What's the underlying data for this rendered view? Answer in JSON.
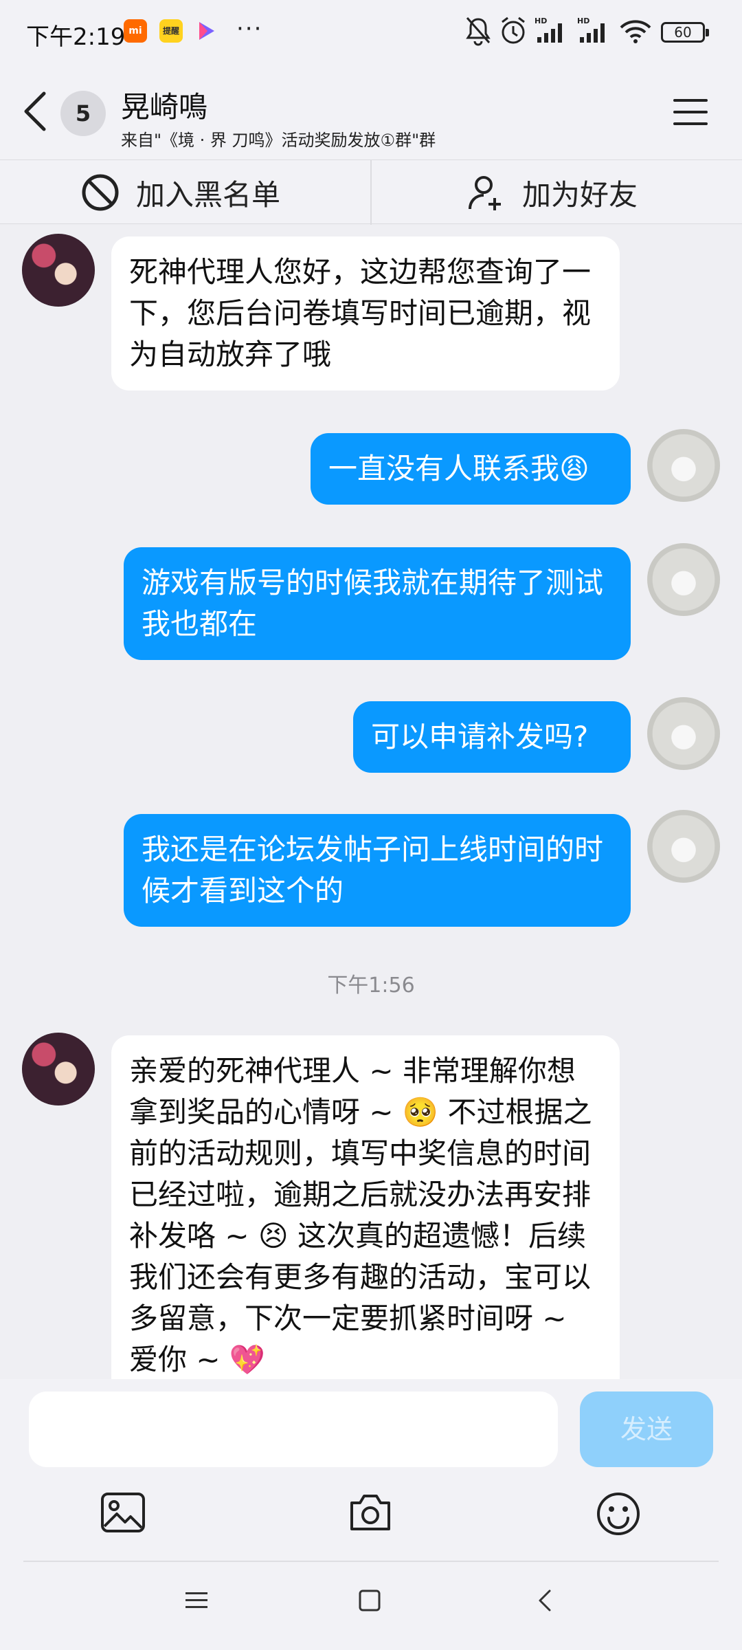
{
  "status_bar": {
    "time": "下午2:19",
    "apps": [
      "mi",
      "提醒",
      "play"
    ],
    "more": "···",
    "battery": "60"
  },
  "header": {
    "unread_count": "5",
    "title": "晃崎鳴",
    "subtitle": "来自\"《境 · 界 刀鸣》活动奖励发放①群\"群"
  },
  "actions": {
    "blacklist_label": "加入黑名单",
    "add_friend_label": "加为好友"
  },
  "messages": [
    {
      "side": "left",
      "text": "死神代理人您好，这边帮您查询了一下，您后台问卷填写时间已逾期，视为自动放弃了哦"
    },
    {
      "side": "right",
      "text": "一直没有人联系我😩"
    },
    {
      "side": "right",
      "text": "游戏有版号的时候我就在期待了测试我也都在"
    },
    {
      "side": "right",
      "text": "可以申请补发吗?"
    },
    {
      "side": "right",
      "text": "我还是在论坛发帖子问上线时间的时候才看到这个的"
    },
    {
      "side": "left",
      "text": "亲爱的死神代理人 ~ 非常理解你想拿到奖品的心情呀 ~ 🥺 不过根据之前的活动规则，填写中奖信息的时间已经过啦，逾期之后就没办法再安排补发咯 ~ 😣 这次真的超遗憾！后续我们还会有更多有趣的活动，宝可以多留意，下次一定要抓紧时间呀 ~ 爱你 ~ 💖"
    }
  ],
  "timestamp": "下午1:56",
  "input": {
    "placeholder": "",
    "send_label": "发送"
  },
  "toolbar_icons": [
    "image-icon",
    "camera-icon",
    "emoji-icon"
  ],
  "colors": {
    "outgoing_bubble": "#0a99ff",
    "send_button_disabled": "#8fd0fb",
    "background": "#efeff3"
  }
}
